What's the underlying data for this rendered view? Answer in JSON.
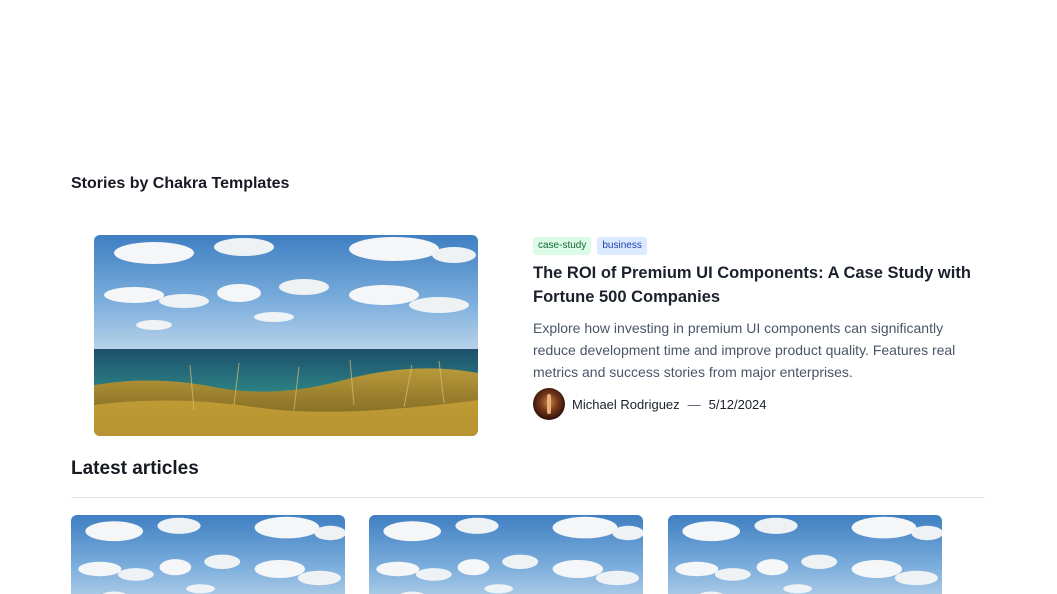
{
  "stories": {
    "title": "Stories by Chakra Templates"
  },
  "featured": {
    "image": "seascape-photo",
    "tags": [
      "case-study",
      "business"
    ],
    "title": "The ROI of Premium UI Components: A Case Study with Fortune 500 Companies",
    "excerpt": "Explore how investing in premium UI components can significantly reduce development time and improve product quality. Features real metrics and success stories from major enterprises.",
    "author": "Michael Rodriguez",
    "separator": "—",
    "date": "5/12/2024"
  },
  "latest": {
    "title": "Latest articles",
    "cards": [
      {
        "image": "seascape-photo"
      },
      {
        "image": "seascape-photo"
      },
      {
        "image": "seascape-photo"
      }
    ]
  },
  "colors": {
    "tag_green_bg": "#dcfce7",
    "tag_blue_bg": "#dbeafe",
    "text_primary": "#1a202c",
    "text_muted": "#4a5568"
  }
}
